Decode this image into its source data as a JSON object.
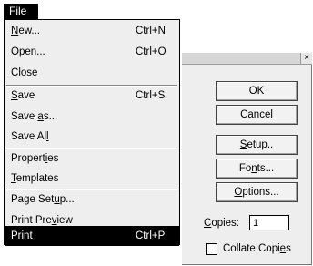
{
  "menubar": {
    "file_label": "File"
  },
  "file_menu": {
    "items": [
      {
        "pre": "",
        "ul": "N",
        "post": "ew...",
        "shortcut": "Ctrl+N"
      },
      {
        "pre": "",
        "ul": "O",
        "post": "pen...",
        "shortcut": "Ctrl+O"
      },
      {
        "pre": "",
        "ul": "C",
        "post": "lose",
        "shortcut": ""
      },
      {
        "pre": "",
        "ul": "S",
        "post": "ave",
        "shortcut": "Ctrl+S"
      },
      {
        "pre": "Save ",
        "ul": "a",
        "post": "s...",
        "shortcut": ""
      },
      {
        "pre": "Save Al",
        "ul": "l",
        "post": "",
        "shortcut": ""
      },
      {
        "pre": "Propert",
        "ul": "i",
        "post": "es",
        "shortcut": ""
      },
      {
        "pre": "",
        "ul": "T",
        "post": "emplates",
        "shortcut": ""
      },
      {
        "pre": "Page Set",
        "ul": "u",
        "post": "p...",
        "shortcut": ""
      },
      {
        "pre": "Print Pre",
        "ul": "v",
        "post": "iew",
        "shortcut": ""
      },
      {
        "pre": "",
        "ul": "P",
        "post": "rint",
        "shortcut": "Ctrl+P"
      }
    ]
  },
  "print_dialog": {
    "close_glyph": "×",
    "ok_label": "OK",
    "cancel_label": "Cancel",
    "setup": {
      "pre": "",
      "ul": "S",
      "post": "etup.."
    },
    "fonts": {
      "pre": "Fo",
      "ul": "n",
      "post": "ts..."
    },
    "options": {
      "pre": "",
      "ul": "O",
      "post": "ptions..."
    },
    "copies_label": {
      "pre": "",
      "ul": "C",
      "post": "opies:"
    },
    "copies_value": "1",
    "collate": {
      "pre": "Collate Copi",
      "ul": "e",
      "post": "s"
    },
    "collate_checked": false
  }
}
